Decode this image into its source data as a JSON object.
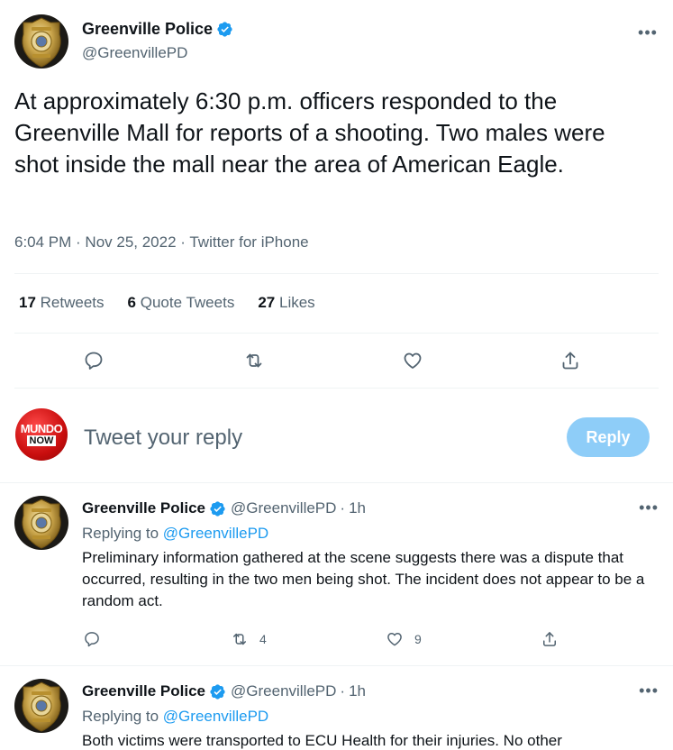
{
  "account": {
    "display_name": "Greenville Police",
    "handle": "@GreenvillePD",
    "verified": true
  },
  "main_tweet": {
    "text": "At approximately 6:30 p.m. officers responded to the Greenville Mall for reports of a shooting. Two males were shot inside the mall near the area of American Eagle.",
    "meta": "6:04 PM · Nov 25, 2022 · Twitter for iPhone",
    "stats": {
      "retweets_count": "17",
      "retweets_label": "Retweets",
      "quotes_count": "6",
      "quotes_label": "Quote Tweets",
      "likes_count": "27",
      "likes_label": "Likes"
    }
  },
  "reply_composer": {
    "avatar_top": "MUNDO",
    "avatar_bottom": "NOW",
    "placeholder": "Tweet your reply",
    "button_label": "Reply"
  },
  "replies": [
    {
      "display_name": "Greenville Police",
      "handle": "@GreenvillePD",
      "time": "1h",
      "replying_label": "Replying to",
      "replying_handle": "@GreenvillePD",
      "text": "Preliminary information gathered at the scene suggests there was a dispute that occurred, resulting in the two men being shot. The incident does not appear to be a random act.",
      "retweets": "4",
      "likes": "9"
    },
    {
      "display_name": "Greenville Police",
      "handle": "@GreenvillePD",
      "time": "1h",
      "replying_label": "Replying to",
      "replying_handle": "@GreenvillePD",
      "text": "Both victims were transported to ECU Health for their injuries. No other"
    }
  ],
  "colors": {
    "accent": "#1d9bf0",
    "secondary_text": "#536471",
    "reply_button_disabled": "#8ecdf8",
    "badge_gold": "#c9a44a"
  }
}
